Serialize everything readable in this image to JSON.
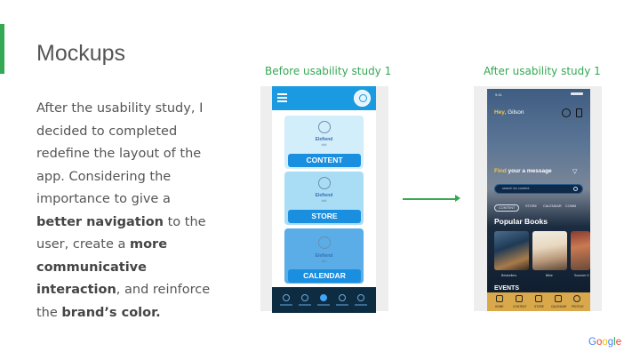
{
  "slide": {
    "title": "Mockups",
    "body": {
      "p1": "After the usability study, I decided to completed redefine the layout of the app. Considering the importance to give a ",
      "b1": "better navigation",
      "p2": " to the user, create a ",
      "b2": "more communicative interaction",
      "p3": ", and reinforce the ",
      "b3": "brand’s color."
    },
    "captions": {
      "before": "Before usability study 1",
      "after": "After usability study 1"
    }
  },
  "before_mockup": {
    "cards": [
      {
        "name": "Eleftend",
        "sub": "###",
        "button": "CONTENT"
      },
      {
        "name": "Eleftend",
        "sub": "###",
        "button": "STORE"
      },
      {
        "name": "Eleftend",
        "sub": "###",
        "button": "CALENDAR"
      }
    ]
  },
  "after_mockup": {
    "status_time": "9:41",
    "greeting_prefix": "Hey,",
    "greeting_name": "Gilson",
    "find_highlight": "Find",
    "find_rest": " your a message",
    "search_placeholder": "search for content",
    "tabs": [
      "CONTENT",
      "STORE",
      "CALENDAR",
      "COMM"
    ],
    "popular_title": "Popular Books",
    "book_labels": [
      "Bestsellers",
      "Bible",
      "Summer D"
    ],
    "events_title": "EVENTS",
    "nav": [
      "HOME",
      "CONTENT",
      "STORE",
      "CALENDAR",
      "PROFILE"
    ]
  },
  "branding": {
    "logo_text": "Google",
    "accent_color": "#34a853"
  }
}
